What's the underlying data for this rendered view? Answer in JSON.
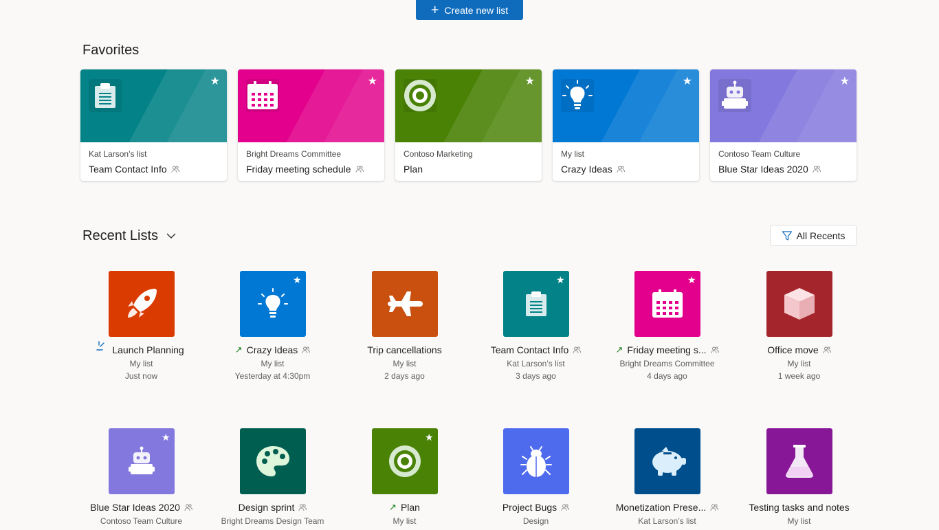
{
  "toolbar": {
    "create_label": "Create new list"
  },
  "favorites": {
    "title": "Favorites",
    "cards": [
      {
        "owner": "Kat Larson’s list",
        "name": "Team Contact Info",
        "color": "#038387",
        "icon": "clipboard-icon"
      },
      {
        "owner": "Bright Dreams Committee",
        "name": "Friday meeting schedule",
        "color": "#e3008c",
        "icon": "calendar-icon"
      },
      {
        "owner": "Contoso Marketing",
        "name": "Plan",
        "color": "#498205",
        "icon": "target-icon"
      },
      {
        "owner": "My list",
        "name": "Crazy Ideas",
        "color": "#0078d4",
        "icon": "lightbulb-icon"
      },
      {
        "owner": "Contoso Team Culture",
        "name": "Blue Star Ideas 2020",
        "color": "#8378de",
        "icon": "robot-icon"
      }
    ]
  },
  "recent": {
    "title": "Recent Lists",
    "filter_label": "All Recents",
    "items": [
      {
        "name": "Launch Planning",
        "owner": "My list",
        "time": "Just now",
        "color": "#da3b01",
        "icon": "rocket-icon"
      },
      {
        "name": "Crazy Ideas",
        "owner": "My list",
        "time": "Yesterday at 4:30pm",
        "color": "#0078d4",
        "icon": "lightbulb-icon"
      },
      {
        "name": "Trip cancellations",
        "owner": "My list",
        "time": "2 days ago",
        "color": "#ca5010",
        "icon": "airplane-icon"
      },
      {
        "name": "Team Contact Info",
        "owner": "Kat Larson’s list",
        "time": "3 days ago",
        "color": "#038387",
        "icon": "clipboard-icon"
      },
      {
        "name": "Friday meeting s...",
        "owner": "Bright Dreams Committee",
        "time": "4 days ago",
        "color": "#e3008c",
        "icon": "calendar-icon"
      },
      {
        "name": "Office move",
        "owner": "My list",
        "time": "1 week ago",
        "color": "#a4262c",
        "icon": "cube-icon"
      },
      {
        "name": "Blue Star Ideas 2020",
        "owner": "Contoso Team Culture",
        "time": "",
        "color": "#8378de",
        "icon": "robot-icon"
      },
      {
        "name": "Design sprint",
        "owner": "Bright Dreams Design Team",
        "time": "",
        "color": "#005e50",
        "icon": "palette-icon"
      },
      {
        "name": "Plan",
        "owner": "My list",
        "time": "",
        "color": "#498205",
        "icon": "target-icon"
      },
      {
        "name": "Project Bugs",
        "owner": "Design",
        "time": "",
        "color": "#4f6bed",
        "icon": "bug-icon"
      },
      {
        "name": "Monetization Prese...",
        "owner": "Kat Larson’s list",
        "time": "",
        "color": "#004e8c",
        "icon": "piggy-bank-icon"
      },
      {
        "name": "Testing tasks and notes",
        "owner": "My list",
        "time": "",
        "color": "#881798",
        "icon": "flask-icon"
      }
    ]
  }
}
